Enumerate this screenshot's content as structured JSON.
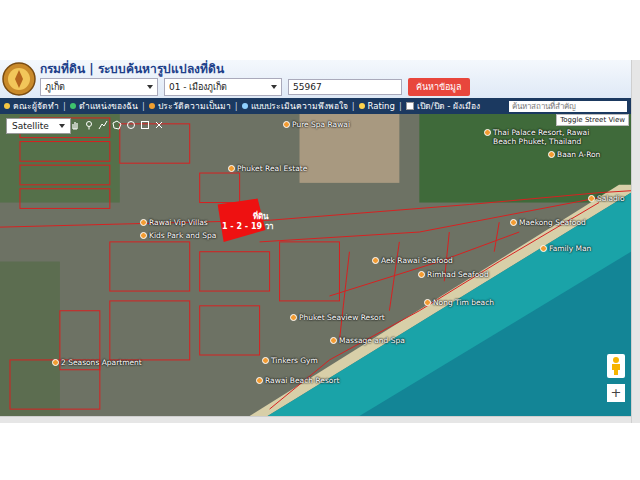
{
  "header": {
    "title": "กรมที่ดิน | ระบบค้นหารูปแปลงที่ดิน"
  },
  "search": {
    "province": "ภูเก็ต",
    "district": "01 - เมืองภูเก็ต",
    "parcel": "55967",
    "button": "ค้นหาข้อมูล"
  },
  "toolbar": {
    "separator": "|",
    "items": [
      {
        "label": "คณะผู้จัดทำ",
        "kind": "link"
      },
      {
        "label": "ตำแหน่งของฉัน",
        "kind": "link"
      },
      {
        "label": "ประวัติความเป็นมา",
        "kind": "link"
      },
      {
        "label": "แบบประเมินความพึงพอใจ",
        "kind": "link"
      },
      {
        "label": "Rating",
        "kind": "link"
      },
      {
        "label": "เปิด/ปิด - ผังเมือง",
        "kind": "toggle",
        "checked": false
      }
    ],
    "placeholder": "ค้นหาสถานที่สำคัญ"
  },
  "map": {
    "layer": "Satellite",
    "street_view": "Toggle Street View",
    "zoom_in": "+",
    "parcel": {
      "title": "ที่ดิน",
      "area": "1 - 2 - 19 วา"
    },
    "places": [
      "Pure Spa Rawai",
      "Phuket Real Estate",
      "Rawai Vip Villas",
      "Kids Park and Spa",
      "Aek Rawai Seafood",
      "Rimhad Seafood",
      "Nong Tim beach",
      "Phuket Seaview Resort",
      "Massage and Spa",
      "Tinkers Gym",
      "Rawai Beach Resort",
      "2 Seasons Apartment",
      "Baan A-Ron",
      "Thai Palace Resort, Rawai Beach Phuket, Thailand",
      "Maekong Seafood",
      "Family Man",
      "Saladio"
    ]
  }
}
